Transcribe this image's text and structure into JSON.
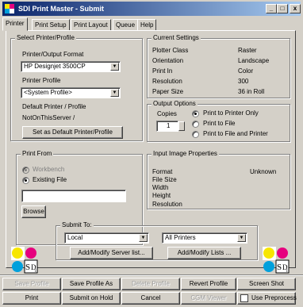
{
  "window": {
    "title": "SDI Print Master - Submit",
    "controls": {
      "minimize": "_",
      "maximize": "□",
      "close": "x"
    }
  },
  "tabs": [
    {
      "label": "Printer",
      "active": true
    },
    {
      "label": "Print Setup"
    },
    {
      "label": "Print Layout"
    },
    {
      "label": "Queue"
    },
    {
      "label": "Help"
    }
  ],
  "select_printer": {
    "title": "Select Printer/Profile",
    "format_label": "Printer/Output Format",
    "format_value": "HP Designjet 3500CP",
    "profile_label": "Printer Profile",
    "profile_value": "<System Profile>",
    "default_label": "Default Printer / Profile",
    "default_value": "NotOnThisServer /",
    "set_default_button": "Set as Default Printer/Profile"
  },
  "current_settings": {
    "title": "Current Settings",
    "rows": [
      {
        "label": "Plotter Class",
        "value": "Raster"
      },
      {
        "label": "Orientation",
        "value": "Landscape"
      },
      {
        "label": "Print In",
        "value": "Color"
      },
      {
        "label": "Resolution",
        "value": "300"
      },
      {
        "label": "Paper Size",
        "value": "36 in Roll"
      }
    ]
  },
  "output_options": {
    "title": "Output Options",
    "copies_label": "Copies",
    "copies_value": "1",
    "options": [
      {
        "label": "Print to Printer Only",
        "checked": true
      },
      {
        "label": "Print to File",
        "checked": false
      },
      {
        "label": "Print to File and Printer",
        "checked": false
      }
    ]
  },
  "print_from": {
    "title": "Print From",
    "workbench_label": "Workbench",
    "existing_label": "Existing File",
    "file_value": "",
    "browse_button": "Browse"
  },
  "input_image": {
    "title": "Input Image Properties",
    "format_label": "Format",
    "format_value": "Unknown",
    "file_size_label": "File Size",
    "width_label": "Width",
    "height_label": "Height",
    "resolution_label": "Resolution"
  },
  "submit_to": {
    "title": "Submit To:",
    "server_value": "Local",
    "printers_value": "All Printers",
    "add_server_button": "Add/Modify Server list...",
    "add_lists_button": "Add/Modify Lists ..."
  },
  "logo_text": {
    "s": "S",
    "d": "D",
    "sub": "I"
  },
  "bottom_row1": [
    {
      "label": "Save Profile",
      "disabled": true
    },
    {
      "label": "Save Profile As"
    },
    {
      "label": "Delete Profile",
      "disabled": true
    },
    {
      "label": "Revert Profile"
    },
    {
      "label": "Screen Shot"
    }
  ],
  "bottom_row2": [
    {
      "label": "Print"
    },
    {
      "label": "Submit on Hold"
    },
    {
      "label": "Cancel"
    },
    {
      "label": "CGM Viewer",
      "disabled": true
    }
  ],
  "use_preprocess": {
    "label": "Use Preprocess",
    "checked": false
  },
  "colors": {
    "face": "#d4d0c8",
    "title_start": "#0a246a",
    "title_end": "#a6caf0",
    "logo_yellow": "#f7e600",
    "logo_magenta": "#e6007e",
    "logo_cyan": "#00a0dc"
  }
}
